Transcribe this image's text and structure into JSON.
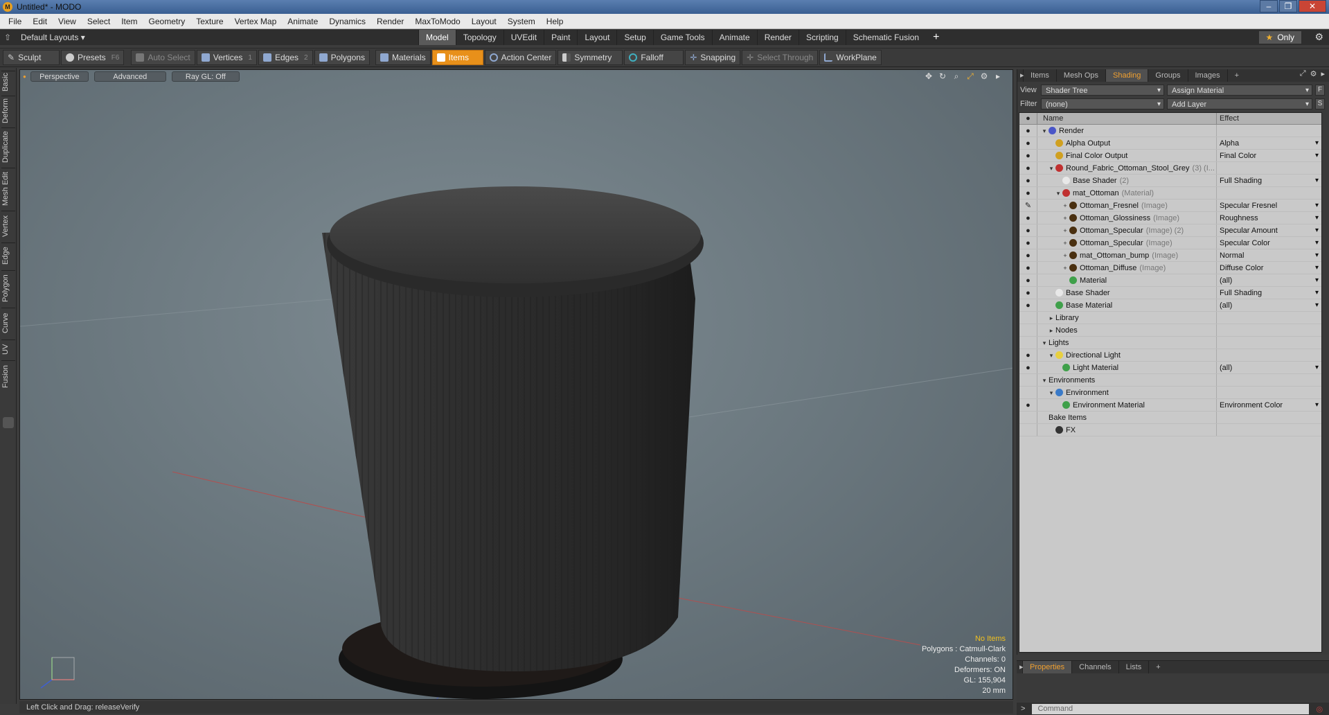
{
  "window": {
    "title": "Untitled* - MODO",
    "app_icon": "modo-icon",
    "controls": [
      "minimize-icon",
      "restore-icon",
      "close-icon"
    ]
  },
  "menu": [
    "File",
    "Edit",
    "View",
    "Select",
    "Item",
    "Geometry",
    "Texture",
    "Vertex Map",
    "Animate",
    "Dynamics",
    "Render",
    "MaxToModo",
    "Layout",
    "System",
    "Help"
  ],
  "layoutbar": {
    "layout_name": "Default Layouts ▾",
    "tabs": [
      "Model",
      "Topology",
      "UVEdit",
      "Paint",
      "Layout",
      "Setup",
      "Game Tools",
      "Animate",
      "Render",
      "Scripting",
      "Schematic Fusion"
    ],
    "active_tab": "Model",
    "add_tab": "+",
    "only_label": "Only"
  },
  "toolbar": {
    "sculpt": "Sculpt",
    "presets": "Presets",
    "presets_key": "F6",
    "auto_select": "Auto Select",
    "vertices": "Vertices",
    "vertices_key": "1",
    "edges": "Edges",
    "edges_key": "2",
    "polygons": "Polygons",
    "materials": "Materials",
    "items": "Items",
    "action_center": "Action Center",
    "symmetry": "Symmetry",
    "falloff": "Falloff",
    "snapping": "Snapping",
    "select_through": "Select Through",
    "workplane": "WorkPlane"
  },
  "left_tabs": [
    "Basic",
    "Deform",
    "Duplicate",
    "Mesh Edit",
    "Vertex",
    "Edge",
    "Polygon",
    "Curve",
    "UV",
    "Fusion"
  ],
  "viewport": {
    "view": "Perspective",
    "shading": "Advanced",
    "raygl": "Ray GL: Off",
    "info": {
      "items": "No Items",
      "polygons": "Polygons : Catmull-Clark",
      "channels": "Channels: 0",
      "deformers": "Deformers: ON",
      "gl": "GL: 155,904",
      "scale": "20 mm"
    }
  },
  "status": {
    "hint": "Left Click and Drag:  releaseVerify"
  },
  "right_panel": {
    "tabs": [
      "Items",
      "Mesh Ops",
      "Shading",
      "Groups",
      "Images",
      "+"
    ],
    "active_tab": "Shading",
    "view_label": "View",
    "view_value": "Shader Tree",
    "assign_material": "Assign Material",
    "assign_key": "F",
    "filter_label": "Filter",
    "filter_value": "(none)",
    "add_layer": "Add Layer",
    "add_key": "S",
    "col_name": "Name",
    "col_effect": "Effect",
    "rows": [
      {
        "vis": "●",
        "ar": "▾",
        "indent": 0,
        "icon": "#4a56c8",
        "name": "Render",
        "note": "",
        "effect": "",
        "dd": false
      },
      {
        "vis": "●",
        "ar": "",
        "indent": 1,
        "icon": "#d0a020",
        "name": "Alpha Output",
        "note": "",
        "effect": "Alpha",
        "dd": true
      },
      {
        "vis": "●",
        "ar": "",
        "indent": 1,
        "icon": "#d0a020",
        "name": "Final Color Output",
        "note": "",
        "effect": "Final Color",
        "dd": true
      },
      {
        "vis": "●",
        "ar": "▾",
        "indent": 1,
        "icon": "#c03030",
        "name": "Round_Fabric_Ottoman_Stool_Grey",
        "note": "(3) (I...",
        "effect": "",
        "dd": false
      },
      {
        "vis": "●",
        "ar": "",
        "indent": 2,
        "icon": "#e8e8e8",
        "name": "Base Shader",
        "note": "(2)",
        "effect": "Full Shading",
        "dd": true
      },
      {
        "vis": "●",
        "ar": "▾",
        "indent": 2,
        "icon": "#c03030",
        "name": "mat_Ottoman",
        "note": "(Material)",
        "effect": "",
        "dd": false
      },
      {
        "vis": "✎",
        "ar": "+",
        "indent": 3,
        "icon": "#4a3010",
        "name": "Ottoman_Fresnel",
        "note": "(Image)",
        "effect": "Specular Fresnel",
        "dd": true
      },
      {
        "vis": "●",
        "ar": "+",
        "indent": 3,
        "icon": "#4a3010",
        "name": "Ottoman_Glossiness",
        "note": "(Image)",
        "effect": "Roughness",
        "dd": true
      },
      {
        "vis": "●",
        "ar": "+",
        "indent": 3,
        "icon": "#4a3010",
        "name": "Ottoman_Specular",
        "note": "(Image) (2)",
        "effect": "Specular Amount",
        "dd": true
      },
      {
        "vis": "●",
        "ar": "+",
        "indent": 3,
        "icon": "#4a3010",
        "name": "Ottoman_Specular",
        "note": "(Image)",
        "effect": "Specular Color",
        "dd": true
      },
      {
        "vis": "●",
        "ar": "+",
        "indent": 3,
        "icon": "#4a3010",
        "name": "mat_Ottoman_bump",
        "note": "(Image)",
        "effect": "Normal",
        "dd": true
      },
      {
        "vis": "●",
        "ar": "+",
        "indent": 3,
        "icon": "#4a3010",
        "name": "Ottoman_Diffuse",
        "note": "(Image)",
        "effect": "Diffuse Color",
        "dd": true
      },
      {
        "vis": "●",
        "ar": "",
        "indent": 3,
        "icon": "#3fa04a",
        "name": "Material",
        "note": "",
        "effect": "(all)",
        "dd": true
      },
      {
        "vis": "●",
        "ar": "",
        "indent": 1,
        "icon": "#e8e8e8",
        "name": "Base Shader",
        "note": "",
        "effect": "Full Shading",
        "dd": true
      },
      {
        "vis": "●",
        "ar": "",
        "indent": 1,
        "icon": "#3fa04a",
        "name": "Base Material",
        "note": "",
        "effect": "(all)",
        "dd": true
      },
      {
        "vis": "",
        "ar": "▸",
        "indent": 1,
        "icon": "",
        "name": "Library",
        "note": "",
        "effect": "",
        "dd": false
      },
      {
        "vis": "",
        "ar": "▸",
        "indent": 1,
        "icon": "",
        "name": "Nodes",
        "note": "",
        "effect": "",
        "dd": false
      },
      {
        "vis": "",
        "ar": "▾",
        "indent": 0,
        "icon": "",
        "name": "Lights",
        "note": "",
        "effect": "",
        "dd": false
      },
      {
        "vis": "●",
        "ar": "▾",
        "indent": 1,
        "icon": "#e8d040",
        "name": "Directional Light",
        "note": "",
        "effect": "",
        "dd": false
      },
      {
        "vis": "●",
        "ar": "",
        "indent": 2,
        "icon": "#3fa04a",
        "name": "Light Material",
        "note": "",
        "effect": "(all)",
        "dd": true
      },
      {
        "vis": "",
        "ar": "▾",
        "indent": 0,
        "icon": "",
        "name": "Environments",
        "note": "",
        "effect": "",
        "dd": false
      },
      {
        "vis": "",
        "ar": "▾",
        "indent": 1,
        "icon": "#3a7ac8",
        "name": "Environment",
        "note": "",
        "effect": "",
        "dd": false
      },
      {
        "vis": "●",
        "ar": "",
        "indent": 2,
        "icon": "#3fa04a",
        "name": "Environment Material",
        "note": "",
        "effect": "Environment Color",
        "dd": true
      },
      {
        "vis": "",
        "ar": "",
        "indent": 0,
        "icon": "",
        "name": "Bake Items",
        "note": "",
        "effect": "",
        "dd": false
      },
      {
        "vis": "",
        "ar": "",
        "indent": 1,
        "icon": "#333333",
        "name": "FX",
        "note": "",
        "effect": "",
        "dd": false
      }
    ]
  },
  "bottom_panel": {
    "tabs": [
      "Properties",
      "Channels",
      "Lists",
      "+"
    ],
    "active_tab": "Properties"
  },
  "command": {
    "prompt": ">",
    "placeholder": "Command"
  }
}
